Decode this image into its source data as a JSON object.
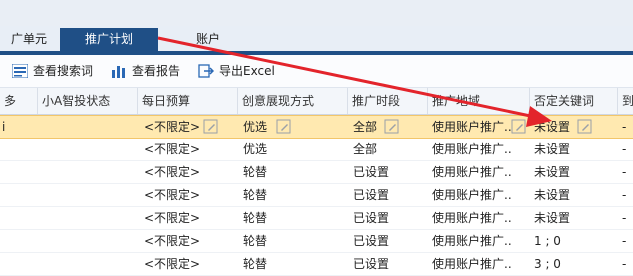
{
  "tabs": {
    "unit": "广单元",
    "plan": "推广计划",
    "account": "账户"
  },
  "toolbar": {
    "search": "查看搜索词",
    "report": "查看报告",
    "export": "导出Excel"
  },
  "columns": [
    "多",
    "小A智投状态",
    "每日预算",
    "创意展现方式",
    "推广时段",
    "推广地域",
    "否定关键词",
    "到"
  ],
  "rows": [
    {
      "col0": "i",
      "budget": "<不限定>",
      "creative": "优选",
      "time": "全部",
      "region": "使用账户推广...",
      "neg": "未设置",
      "end": "-"
    },
    {
      "col0": "",
      "budget": "<不限定>",
      "creative": "优选",
      "time": "全部",
      "region": "使用账户推广...",
      "neg": "未设置",
      "end": "-"
    },
    {
      "col0": "",
      "budget": "<不限定>",
      "creative": "轮替",
      "time": "已设置",
      "region": "使用账户推广...",
      "neg": "未设置",
      "end": "-"
    },
    {
      "col0": "",
      "budget": "<不限定>",
      "creative": "轮替",
      "time": "已设置",
      "region": "使用账户推广...",
      "neg": "未设置",
      "end": "-"
    },
    {
      "col0": "",
      "budget": "<不限定>",
      "creative": "轮替",
      "time": "已设置",
      "region": "使用账户推广...",
      "neg": "未设置",
      "end": "-"
    },
    {
      "col0": "",
      "budget": "<不限定>",
      "creative": "轮替",
      "time": "已设置",
      "region": "使用账户推广...",
      "neg": "1 ; 0",
      "end": "-"
    },
    {
      "col0": "",
      "budget": "<不限定>",
      "creative": "轮替",
      "time": "已设置",
      "region": "使用账户推广...",
      "neg": "3 ; 0",
      "end": "-"
    }
  ],
  "colors": {
    "tab_active": "#1f4f86",
    "selected_row": "#ffe9b0",
    "arrow": "#e3242b"
  }
}
